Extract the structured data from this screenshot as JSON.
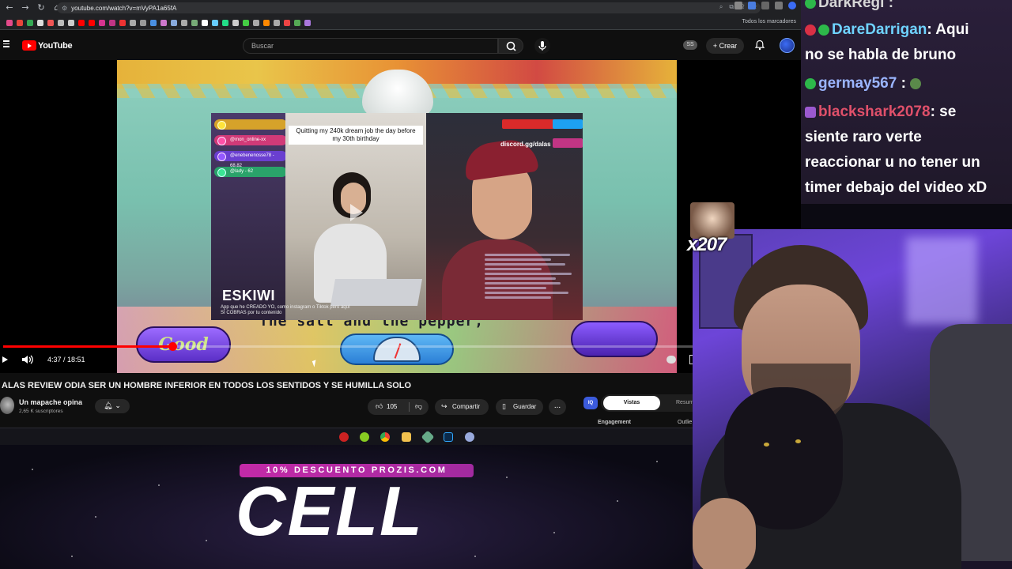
{
  "browser": {
    "url": "youtube.com/watch?v=mVyPA1a65fA",
    "bookmarks_all": "Todos los marcadores"
  },
  "youtube": {
    "logo_text": "YouTube",
    "search_placeholder": "Buscar",
    "ss_badge": "SS",
    "create_label": "Crear",
    "player": {
      "time_current": "4:37",
      "time_total": "18:51",
      "time_display": "4:37 / 18:51",
      "progress_fraction": 0.245
    },
    "video_title": "ALAS REVIEW ODIA SER UN HOMBRE INFERIOR EN TODOS LOS SENTIDOS Y SE HUMILLA SOLO",
    "channel": {
      "name": "Un mapache opina",
      "subscribers": "2,65 K suscriptores"
    },
    "actions": {
      "likes": "105",
      "share": "Compartir",
      "save": "Guardar",
      "more": "..."
    },
    "analytics": {
      "badge": "IQ",
      "tab_active": "Vistas",
      "tab_other": "Resum",
      "label_left": "Engagement",
      "label_right": "Outlie"
    }
  },
  "embedded_video": {
    "caption": "Quitting my 240k dream job the day before my 30th birthday",
    "brand": "ESKIWI",
    "brand_sub": "App que he CREADO YO, como instagram o Tiktok pero aquí SÍ COBRAS por tu contenido",
    "discord": "discord.gg/dalas",
    "chips": [
      "@mon_online-xx",
      "@enebenenosse78 - 68,82",
      "@lady - 62"
    ],
    "subtitle": "The salt and the pepper,",
    "good_label": "Good"
  },
  "chat": {
    "lines": [
      {
        "user": "DarkRegi",
        "message": ""
      },
      {
        "user": "DareDarrigan",
        "message": "Aqui no se habla de bruno"
      },
      {
        "user": "germay567",
        "message": ""
      },
      {
        "user": "blackshark2078",
        "message": "se siente raro verte reaccionar u no tener un timer debajo del video xD"
      }
    ],
    "line1_user": "DarkRegi :",
    "line2_user": "DareDarrigan",
    "line2_msg_a": ": Aqui",
    "line2_msg_b": "no se habla de bruno",
    "line3_user": "germay567",
    "line3_colon": ":",
    "line4_user": "blackshark2078",
    "line4_msg_a": ": se",
    "line4_msg_b": "siente raro verte",
    "line4_msg_c": "reaccionar u no tener un",
    "line4_msg_d": "timer debajo del video xD"
  },
  "emote_combo": "x207",
  "promo": {
    "code_bar": "10% DESCUENTO PROZIS.COM",
    "word": "CELL"
  },
  "colors": {
    "youtube_red": "#ff0000",
    "promo_magenta": "#c32aa7",
    "chat_blue": "#6fd3ff",
    "chat_red": "#e0506a"
  }
}
